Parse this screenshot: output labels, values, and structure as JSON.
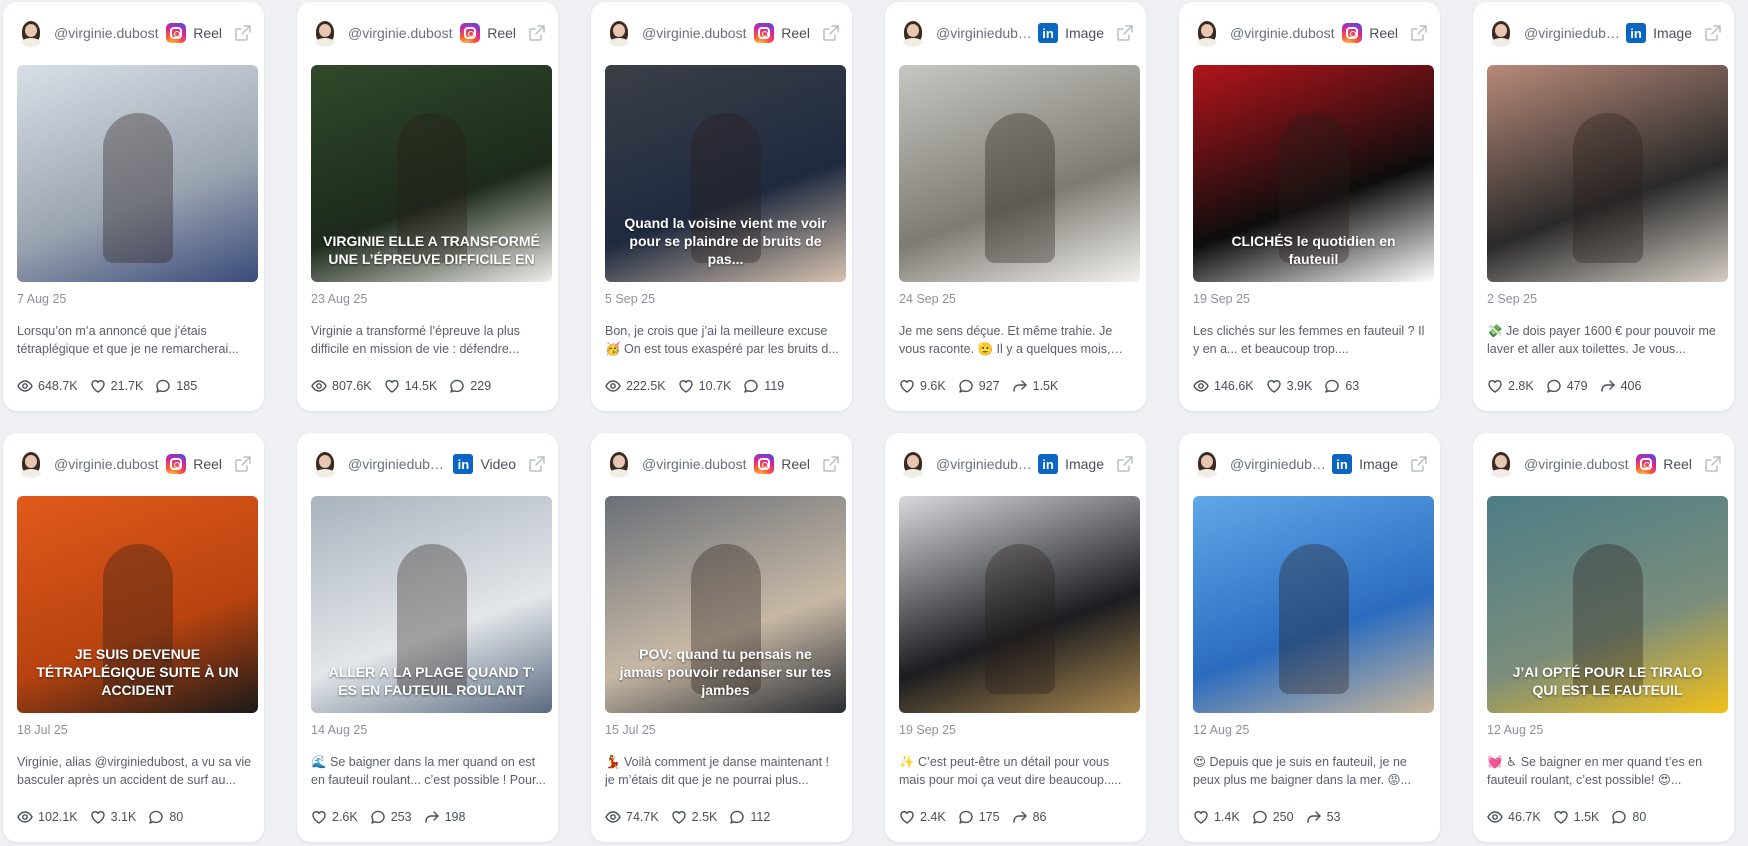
{
  "colors": {
    "accent_instagram": "#d6249f",
    "accent_linkedin": "#0a66c2",
    "card_bg": "#ffffff",
    "page_bg": "#eef0f4"
  },
  "posts": [
    {
      "handle": "@virginie.dubost",
      "network": "instagram",
      "network_icon": "instagram-icon",
      "type_label": "Reel",
      "date": "7 Aug 25",
      "description": "Lorsqu’on m’a annoncé que j’étais tétraplégique et que je ne remarcherai...",
      "stats": [
        {
          "icon": "eye-icon",
          "value": "648.7K"
        },
        {
          "icon": "heart-icon",
          "value": "21.7K"
        },
        {
          "icon": "comment-icon",
          "value": "185"
        }
      ],
      "thumb_text": "",
      "thumb_colors": [
        "#d9dfe6",
        "#9aa3b0",
        "#3a4b7a"
      ]
    },
    {
      "handle": "@virginie.dubost",
      "network": "instagram",
      "network_icon": "instagram-icon",
      "type_label": "Reel",
      "date": "23 Aug 25",
      "description": "Virginie a transformé l’épreuve la plus difficile en mission de vie : défendre...",
      "stats": [
        {
          "icon": "eye-icon",
          "value": "807.6K"
        },
        {
          "icon": "heart-icon",
          "value": "14.5K"
        },
        {
          "icon": "comment-icon",
          "value": "229"
        }
      ],
      "thumb_text": "VIRGINIE ELLE A TRANSFORMÉ UNE L’ÉPREUVE DIFFICILE EN",
      "thumb_colors": [
        "#2f4a2a",
        "#1d2a1c",
        "#f0eee9"
      ]
    },
    {
      "handle": "@virginie.dubost",
      "network": "instagram",
      "network_icon": "instagram-icon",
      "type_label": "Reel",
      "date": "5 Sep 25",
      "description": "Bon, je crois que j’ai la meilleure excuse 🥳 On est tous exaspéré par les bruits d...",
      "stats": [
        {
          "icon": "eye-icon",
          "value": "222.5K"
        },
        {
          "icon": "heart-icon",
          "value": "10.7K"
        },
        {
          "icon": "comment-icon",
          "value": "119"
        }
      ],
      "thumb_text": "Quand la voisine vient me voir pour se plaindre de bruits de pas...",
      "thumb_colors": [
        "#3b3f47",
        "#1f2a3f",
        "#d8c3b0"
      ]
    },
    {
      "handle": "@virginiedubo...",
      "network": "linkedin",
      "network_icon": "linkedin-icon",
      "type_label": "Image",
      "date": "24 Sep 25",
      "description": "Je me sens déçue. Et même trahie. Je vous raconte. 🫡 Il y a quelques mois, j’a...",
      "stats": [
        {
          "icon": "heart-icon",
          "value": "9.6K"
        },
        {
          "icon": "comment-icon",
          "value": "927"
        },
        {
          "icon": "share-icon",
          "value": "1.5K"
        }
      ],
      "thumb_text": "",
      "thumb_colors": [
        "#c8c6c1",
        "#7e7b74",
        "#f4f2ee"
      ]
    },
    {
      "handle": "@virginie.dubost",
      "network": "instagram",
      "network_icon": "instagram-icon",
      "type_label": "Reel",
      "date": "19 Sep 25",
      "description": "Les clichés sur les femmes en fauteuil ? Il y en a... et beaucoup trop....",
      "stats": [
        {
          "icon": "eye-icon",
          "value": "146.6K"
        },
        {
          "icon": "heart-icon",
          "value": "3.9K"
        },
        {
          "icon": "comment-icon",
          "value": "63"
        }
      ],
      "thumb_text": "CLICHÉS le quotidien en fauteuil",
      "thumb_colors": [
        "#b3141c",
        "#0d0d0d",
        "#ffffff"
      ]
    },
    {
      "handle": "@virginiedubo...",
      "network": "linkedin",
      "network_icon": "linkedin-icon",
      "type_label": "Image",
      "date": "2 Sep 25",
      "description": "💸 Je dois payer 1600 € pour pouvoir me laver et aller aux toilettes. Je vous...",
      "stats": [
        {
          "icon": "heart-icon",
          "value": "2.8K"
        },
        {
          "icon": "comment-icon",
          "value": "479"
        },
        {
          "icon": "share-icon",
          "value": "406"
        }
      ],
      "thumb_text": "",
      "thumb_colors": [
        "#b88a7a",
        "#2a2a2a",
        "#d4cdc4"
      ]
    },
    {
      "handle": "@virginie.dubost",
      "network": "instagram",
      "network_icon": "instagram-icon",
      "type_label": "Reel",
      "date": "18 Jul 25",
      "description": "Virginie, alias @virginiedubost, a vu sa vie basculer après un accident de surf au...",
      "stats": [
        {
          "icon": "eye-icon",
          "value": "102.1K"
        },
        {
          "icon": "heart-icon",
          "value": "3.1K"
        },
        {
          "icon": "comment-icon",
          "value": "80"
        }
      ],
      "thumb_text": "JE SUIS DEVENUE TÉTRAPLÉGIQUE SUITE À UN ACCIDENT",
      "thumb_colors": [
        "#e05a1c",
        "#b8430f",
        "#1a1a1a"
      ]
    },
    {
      "handle": "@virginiedubost",
      "network": "linkedin",
      "network_icon": "linkedin-icon",
      "type_label": "Video",
      "date": "14 Aug 25",
      "description": "🌊 Se baigner dans la mer quand on est en fauteuil roulant... c’est possible ! Pour...",
      "stats": [
        {
          "icon": "heart-icon",
          "value": "2.6K"
        },
        {
          "icon": "comment-icon",
          "value": "253"
        },
        {
          "icon": "share-icon",
          "value": "198"
        }
      ],
      "thumb_text": "ALLER À LA PLAGE QUAND T' ES EN FAUTEUIL ROULANT",
      "thumb_colors": [
        "#a9b3bd",
        "#e3e6ea",
        "#5a6b80"
      ]
    },
    {
      "handle": "@virginie.dubost",
      "network": "instagram",
      "network_icon": "instagram-icon",
      "type_label": "Reel",
      "date": "15 Jul 25",
      "description": "💃 Voilà comment je danse maintenant ! je m’étais dit que je ne pourrai plus...",
      "stats": [
        {
          "icon": "eye-icon",
          "value": "74.7K"
        },
        {
          "icon": "heart-icon",
          "value": "2.5K"
        },
        {
          "icon": "comment-icon",
          "value": "112"
        }
      ],
      "thumb_text": "POV: quand tu pensais ne jamais pouvoir redanser sur tes jambes",
      "thumb_colors": [
        "#6a7078",
        "#c7b8a5",
        "#2a2d33"
      ]
    },
    {
      "handle": "@virginiedubo...",
      "network": "linkedin",
      "network_icon": "linkedin-icon",
      "type_label": "Image",
      "date": "19 Sep 25",
      "description": "✨ C’est peut-être un détail pour vous mais pour moi ça veut dire beaucoup.....",
      "stats": [
        {
          "icon": "heart-icon",
          "value": "2.4K"
        },
        {
          "icon": "comment-icon",
          "value": "175"
        },
        {
          "icon": "share-icon",
          "value": "86"
        }
      ],
      "thumb_text": "",
      "thumb_colors": [
        "#d7d9dc",
        "#1b1c20",
        "#a9884f"
      ]
    },
    {
      "handle": "@virginiedubo...",
      "network": "linkedin",
      "network_icon": "linkedin-icon",
      "type_label": "Image",
      "date": "12 Aug 25",
      "description": "😍 Depuis que je suis en fauteuil, je ne peux plus me baigner dans la mer. 😡...",
      "stats": [
        {
          "icon": "heart-icon",
          "value": "1.4K"
        },
        {
          "icon": "comment-icon",
          "value": "250"
        },
        {
          "icon": "share-icon",
          "value": "53"
        }
      ],
      "thumb_text": "",
      "thumb_colors": [
        "#5fa8e8",
        "#2b6cc0",
        "#c9b699"
      ]
    },
    {
      "handle": "@virginie.dubost",
      "network": "instagram",
      "network_icon": "instagram-icon",
      "type_label": "Reel",
      "date": "12 Aug 25",
      "description": "💓 ♿ Se baigner en mer quand t’es en fauteuil roulant, c’est possible! 😍...",
      "stats": [
        {
          "icon": "eye-icon",
          "value": "46.7K"
        },
        {
          "icon": "heart-icon",
          "value": "1.5K"
        },
        {
          "icon": "comment-icon",
          "value": "80"
        }
      ],
      "thumb_text": "J’AI OPTÉ POUR LE TIRALO QUI EST LE FAUTEUIL",
      "thumb_colors": [
        "#4d7d86",
        "#7a8d7c",
        "#f2c018"
      ]
    }
  ]
}
